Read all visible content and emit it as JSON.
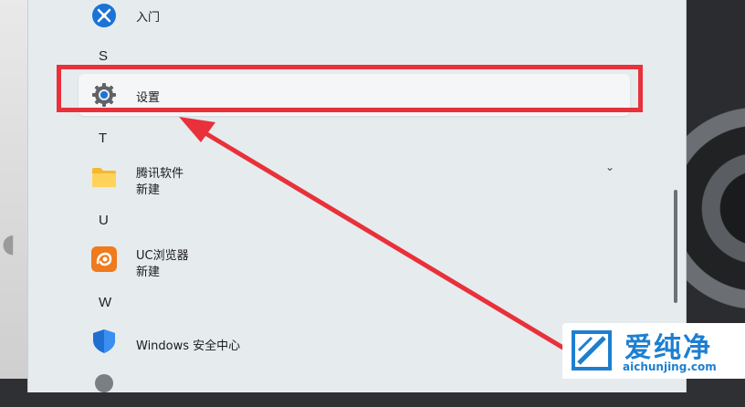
{
  "start_menu": {
    "groups": [
      {
        "letter": "S"
      },
      {
        "letter": "T"
      },
      {
        "letter": "U"
      },
      {
        "letter": "W"
      }
    ],
    "apps": {
      "intro": {
        "name": "入门"
      },
      "settings": {
        "name": "设置"
      },
      "tencent": {
        "name": "腾讯软件",
        "sub": "新建"
      },
      "uc": {
        "name": "UC浏览器",
        "sub": "新建"
      },
      "defender": {
        "name": "Windows 安全中心"
      }
    },
    "expand_icon": "chevron-down-icon"
  },
  "annotation": {
    "color": "#e8313a",
    "target": "设置"
  },
  "watermark": {
    "title": "爱纯净",
    "url": "aichunjing.com",
    "color": "#1e7fd0"
  }
}
